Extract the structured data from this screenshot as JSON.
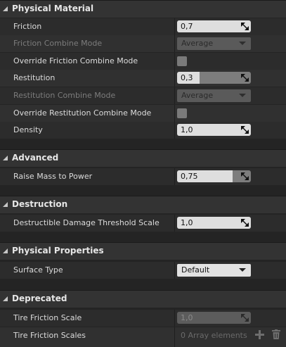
{
  "categories": {
    "physical_material": "Physical Material",
    "advanced": "Advanced",
    "destruction": "Destruction",
    "physical_properties": "Physical Properties",
    "deprecated": "Deprecated"
  },
  "physical_material": {
    "friction": {
      "label": "Friction",
      "value": "0,7"
    },
    "friction_combine_mode": {
      "label": "Friction Combine Mode",
      "value": "Average"
    },
    "override_friction_combine_mode": {
      "label": "Override Friction Combine Mode",
      "checked": false
    },
    "restitution": {
      "label": "Restitution",
      "value": "0,3",
      "fill_fraction": 0.3
    },
    "restitution_combine_mode": {
      "label": "Restitution Combine Mode",
      "value": "Average"
    },
    "override_restitution_combine_mode": {
      "label": "Override Restitution Combine Mode",
      "checked": false
    },
    "density": {
      "label": "Density",
      "value": "1,0"
    }
  },
  "advanced": {
    "raise_mass_to_power": {
      "label": "Raise Mass to Power",
      "value": "0,75",
      "fill_fraction": 0.75
    }
  },
  "destruction": {
    "threshold_scale": {
      "label": "Destructible Damage Threshold Scale",
      "value": "1,0"
    }
  },
  "physical_properties": {
    "surface_type": {
      "label": "Surface Type",
      "value": "Default"
    }
  },
  "deprecated": {
    "tire_friction_scale": {
      "label": "Tire Friction Scale",
      "value": "1,0"
    },
    "tire_friction_scales": {
      "label": "Tire Friction Scales",
      "value": "0 Array elements"
    }
  }
}
